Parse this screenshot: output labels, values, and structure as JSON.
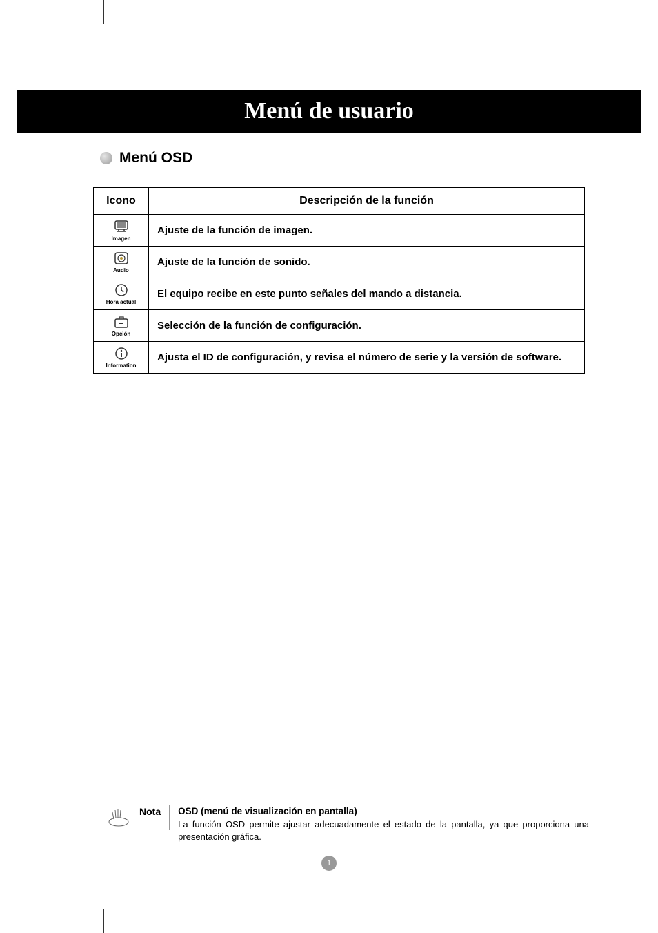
{
  "title": "Menú de usuario",
  "section_title": "Menú OSD",
  "table": {
    "headers": {
      "icon": "Icono",
      "desc": "Descripción de la función"
    },
    "rows": [
      {
        "icon_label": "Imagen",
        "desc": "Ajuste de la función de imagen."
      },
      {
        "icon_label": "Audio",
        "desc": "Ajuste de la función de sonido."
      },
      {
        "icon_label": "Hora actual",
        "desc": "El equipo recibe en este punto señales del mando a distancia."
      },
      {
        "icon_label": "Opción",
        "desc": "Selección de la función de configuración."
      },
      {
        "icon_label": "Information",
        "desc": "Ajusta el ID de configuración, y revisa el número de serie y la versión de software."
      }
    ]
  },
  "note": {
    "label": "Nota",
    "heading": "OSD (menú de visualización en pantalla)",
    "body": "La función OSD permite ajustar adecuadamente el estado de la pantalla, ya que proporciona una presentación gráfica."
  },
  "page_number": "1"
}
